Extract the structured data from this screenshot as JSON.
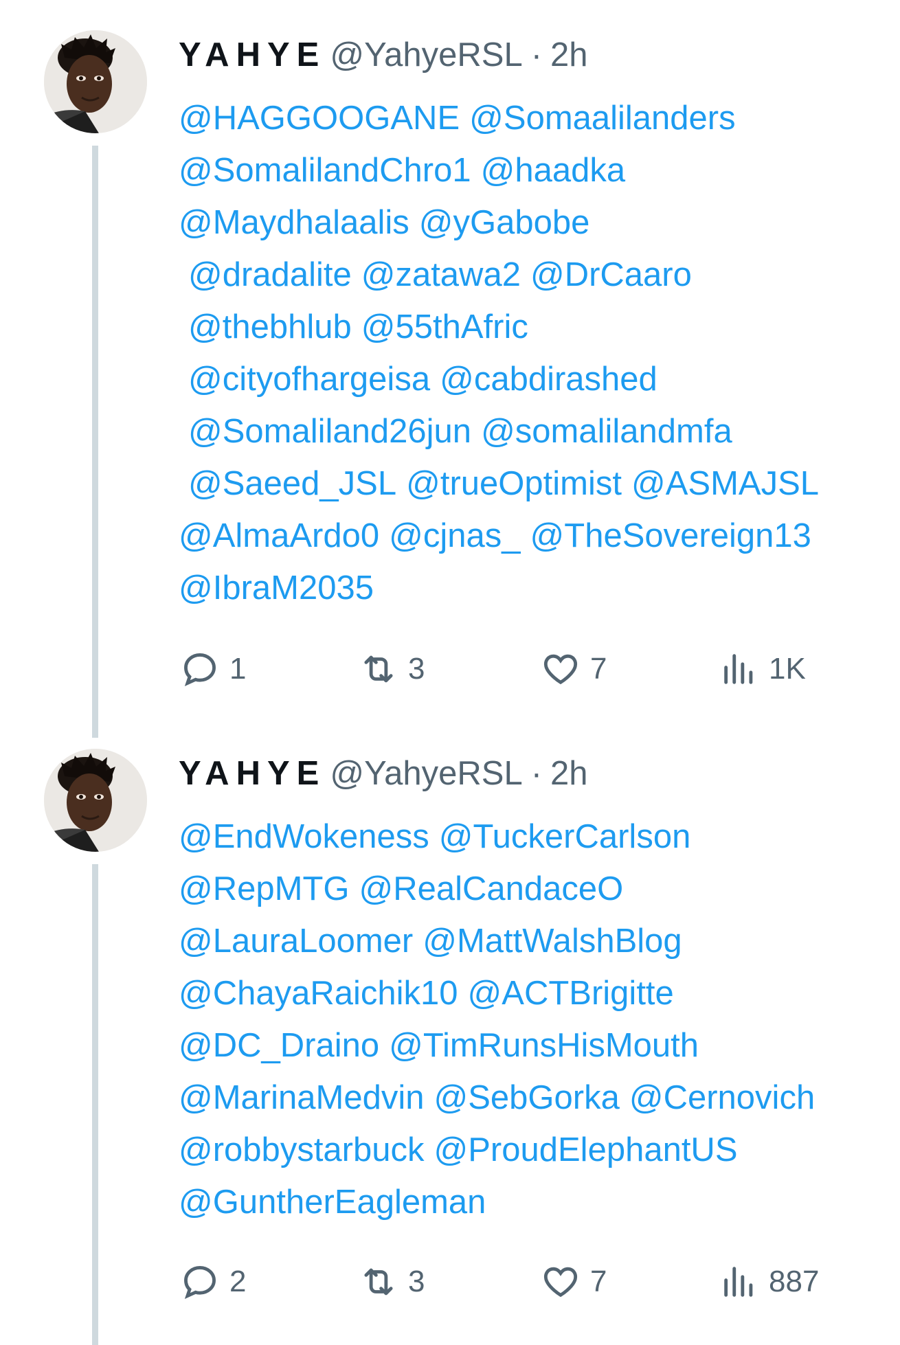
{
  "colors": {
    "link": "#1d9bf0",
    "name": "#0f1419",
    "secondary": "#536471",
    "thread_line": "#cfd9de"
  },
  "tweets": [
    {
      "name": "YAHYE",
      "handle": "@YahyeRSL",
      "separator": "·",
      "time": "2h",
      "lines": [
        [
          "@HAGGOOGANE",
          "@Somaalilanders"
        ],
        [
          "@SomalilandChro1",
          "@haadka"
        ],
        [
          "@Maydhalaalis",
          "@yGabobe"
        ],
        [
          "@dradalite",
          "@zatawa2",
          "@DrCaaro"
        ],
        [
          "@thebhlub",
          "@55thAfric"
        ],
        [
          "@cityofhargeisa",
          "@cabdirashed"
        ],
        [
          "@Somaliland26jun",
          "@somalilandmfa"
        ],
        [
          "@Saeed_JSL",
          "@trueOptimist",
          "@ASMAJSL"
        ],
        [
          "@AlmaArdo0",
          "@cjnas_",
          "@TheSovereign13"
        ],
        [
          "@IbraM2035"
        ]
      ],
      "indented_lines": [
        3,
        4,
        5,
        6,
        7
      ],
      "replies": "1",
      "retweets": "3",
      "likes": "7",
      "views": "1K"
    },
    {
      "name": "YAHYE",
      "handle": "@YahyeRSL",
      "separator": "·",
      "time": "2h",
      "lines": [
        [
          "@EndWokeness",
          "@TuckerCarlson"
        ],
        [
          "@RepMTG",
          "@RealCandaceO"
        ],
        [
          "@LauraLoomer",
          "@MattWalshBlog"
        ],
        [
          "@ChayaRaichik10",
          "@ACTBrigitte"
        ],
        [
          "@DC_Draino",
          "@TimRunsHisMouth"
        ],
        [
          "@MarinaMedvin",
          "@SebGorka",
          "@Cernovich"
        ],
        [
          "@robbystarbuck",
          "@ProudElephantUS"
        ],
        [
          "@GuntherEagleman"
        ]
      ],
      "indented_lines": [],
      "replies": "2",
      "retweets": "3",
      "likes": "7",
      "views": "887"
    }
  ],
  "icons": {
    "reply": "reply-icon",
    "retweet": "retweet-icon",
    "like": "heart-icon",
    "views": "views-icon"
  }
}
